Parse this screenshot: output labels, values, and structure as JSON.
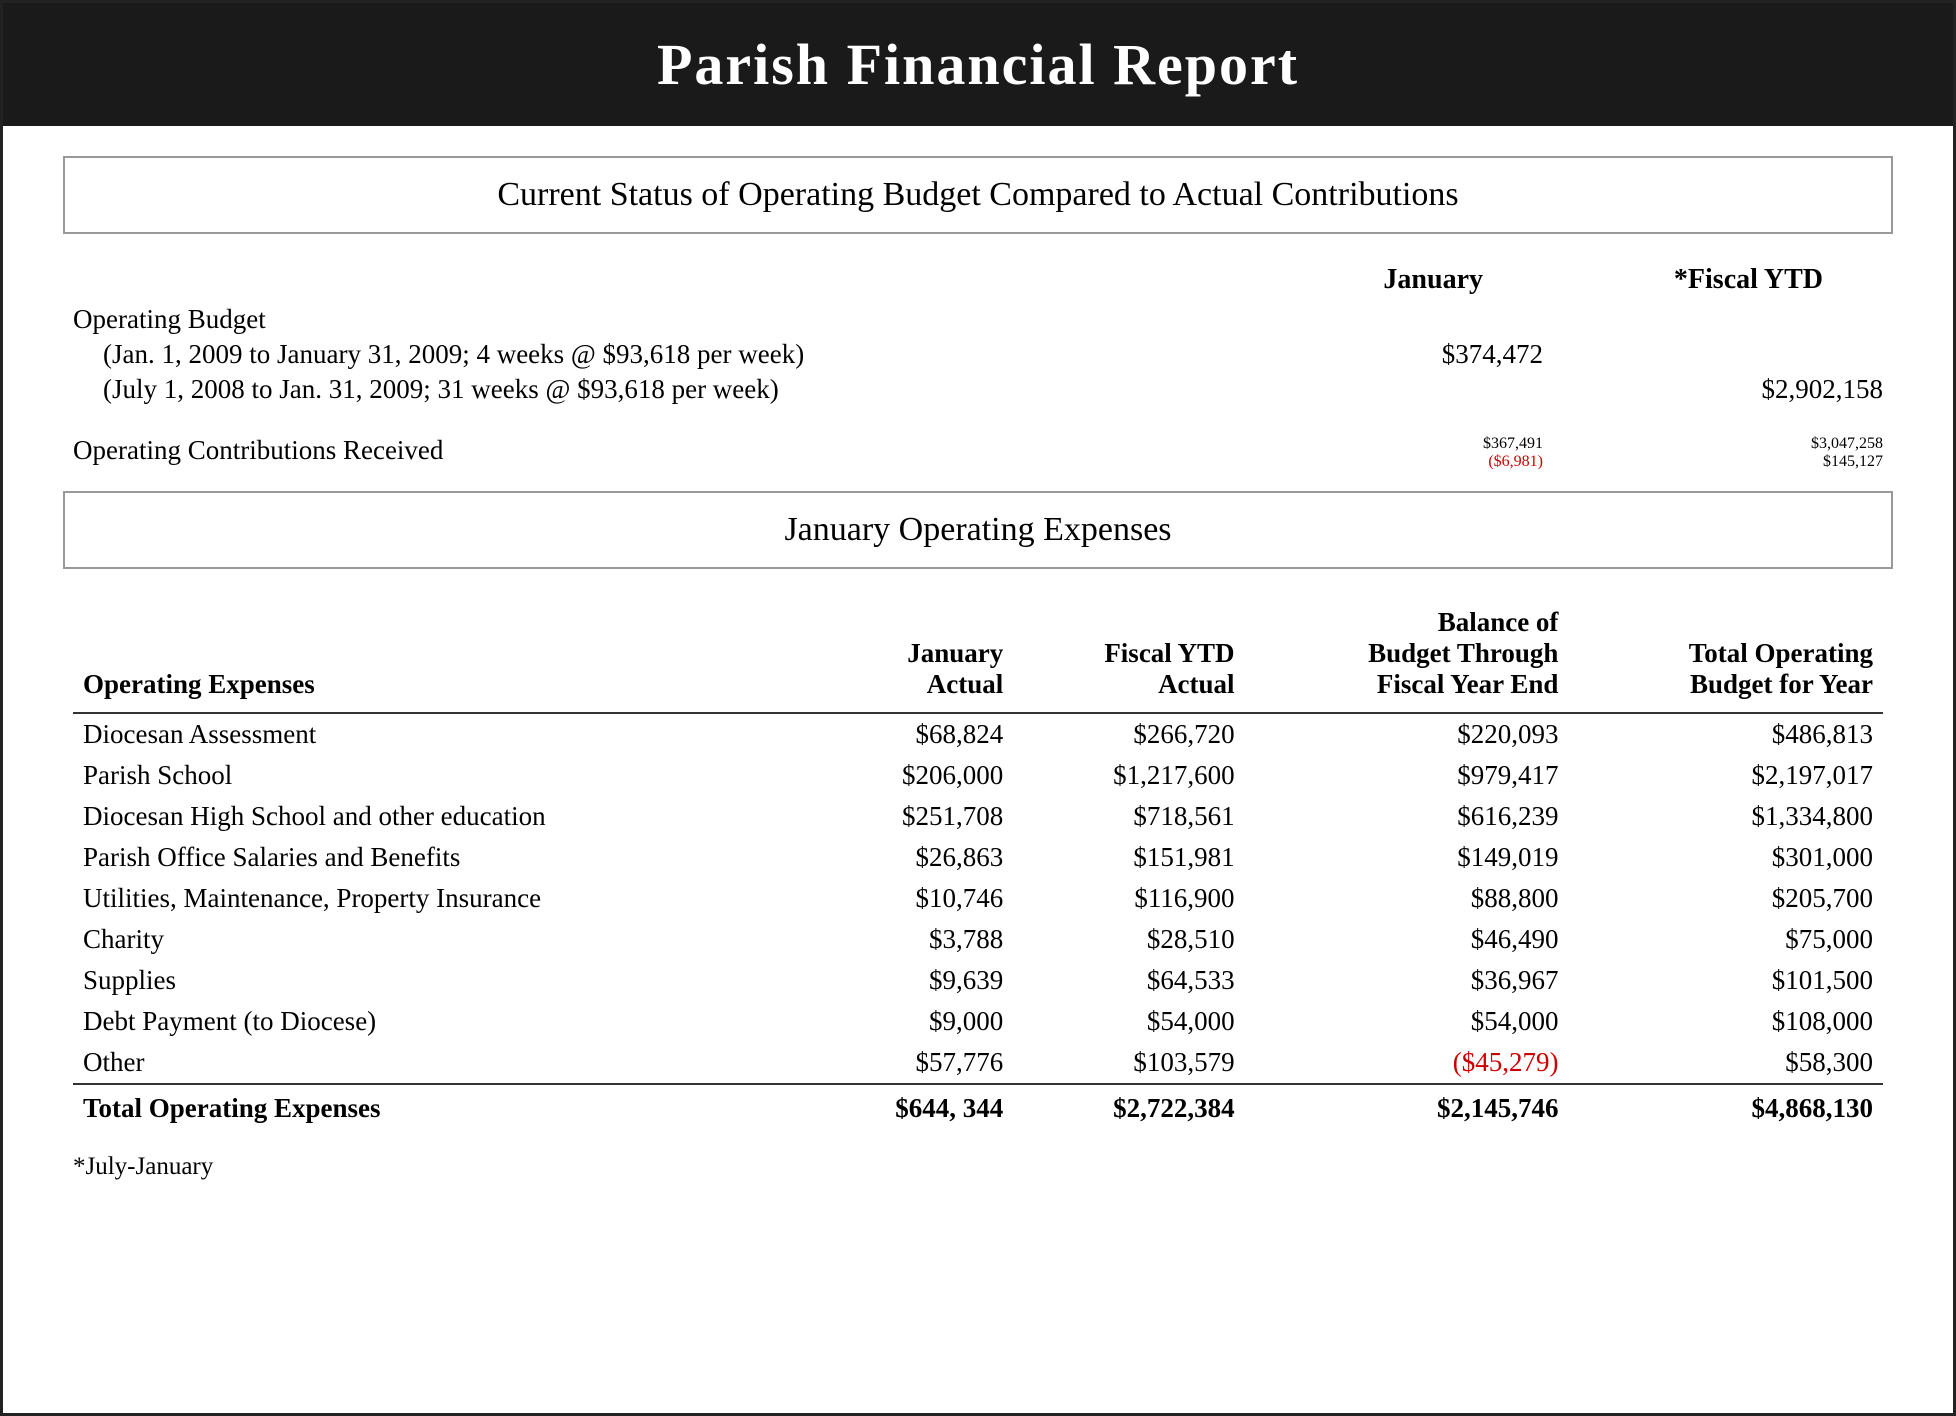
{
  "header": {
    "title": "Parish Financial Report"
  },
  "section1": {
    "title": "Current Status of Operating Budget Compared to Actual Contributions",
    "columns": {
      "jan_header": "January",
      "ytd_header": "*Fiscal YTD"
    },
    "operating_budget": {
      "label": "Operating Budget",
      "line1_label": "(Jan. 1, 2009 to January 31, 2009; 4 weeks @ $93,618 per week)",
      "line1_jan": "$374,472",
      "line1_ytd": "",
      "line2_label": "(July 1, 2008 to Jan. 31, 2009; 31 weeks @ $93,618 per week)",
      "line2_jan": "",
      "line2_ytd": "$2,902,158"
    },
    "contributions": {
      "label": "Operating Contributions Received",
      "jan_value": "$367,491",
      "jan_diff": "($6,981)",
      "ytd_value": "$3,047,258",
      "ytd_diff": "$145,127"
    }
  },
  "section2": {
    "title": "January Operating Expenses",
    "table": {
      "headers": {
        "label": "Operating Expenses",
        "col1": [
          "January",
          "Actual"
        ],
        "col2": [
          "Fiscal YTD",
          "Actual"
        ],
        "col3": [
          "Balance of",
          "Budget Through",
          "Fiscal Year End"
        ],
        "col4": [
          "Total Operating",
          "Budget for Year"
        ]
      },
      "rows": [
        {
          "label": "Diocesan Assessment",
          "jan": "$68,824",
          "ytd": "$266,720",
          "balance": "$220,093",
          "total": "$486,813"
        },
        {
          "label": "Parish School",
          "jan": "$206,000",
          "ytd": "$1,217,600",
          "balance": "$979,417",
          "total": "$2,197,017"
        },
        {
          "label": "Diocesan High School and other education",
          "jan": "$251,708",
          "ytd": "$718,561",
          "balance": "$616,239",
          "total": "$1,334,800"
        },
        {
          "label": "Parish Office Salaries and Benefits",
          "jan": "$26,863",
          "ytd": "$151,981",
          "balance": "$149,019",
          "total": "$301,000"
        },
        {
          "label": "Utilities, Maintenance, Property Insurance",
          "jan": "$10,746",
          "ytd": "$116,900",
          "balance": "$88,800",
          "total": "$205,700"
        },
        {
          "label": "Charity",
          "jan": "$3,788",
          "ytd": "$28,510",
          "balance": "$46,490",
          "total": "$75,000"
        },
        {
          "label": "Supplies",
          "jan": "$9,639",
          "ytd": "$64,533",
          "balance": "$36,967",
          "total": "$101,500"
        },
        {
          "label": "Debt Payment (to Diocese)",
          "jan": "$9,000",
          "ytd": "$54,000",
          "balance": "$54,000",
          "total": "$108,000"
        },
        {
          "label": "Other",
          "jan": "$57,776",
          "ytd": "$103,579",
          "balance": "($45,279)",
          "balance_red": true,
          "total": "$58,300"
        }
      ],
      "total_row": {
        "label": "Total Operating Expenses",
        "jan": "$644, 344",
        "ytd": "$2,722,384",
        "balance": "$2,145,746",
        "total": "$4,868,130"
      }
    },
    "footnote": "*July-January"
  }
}
